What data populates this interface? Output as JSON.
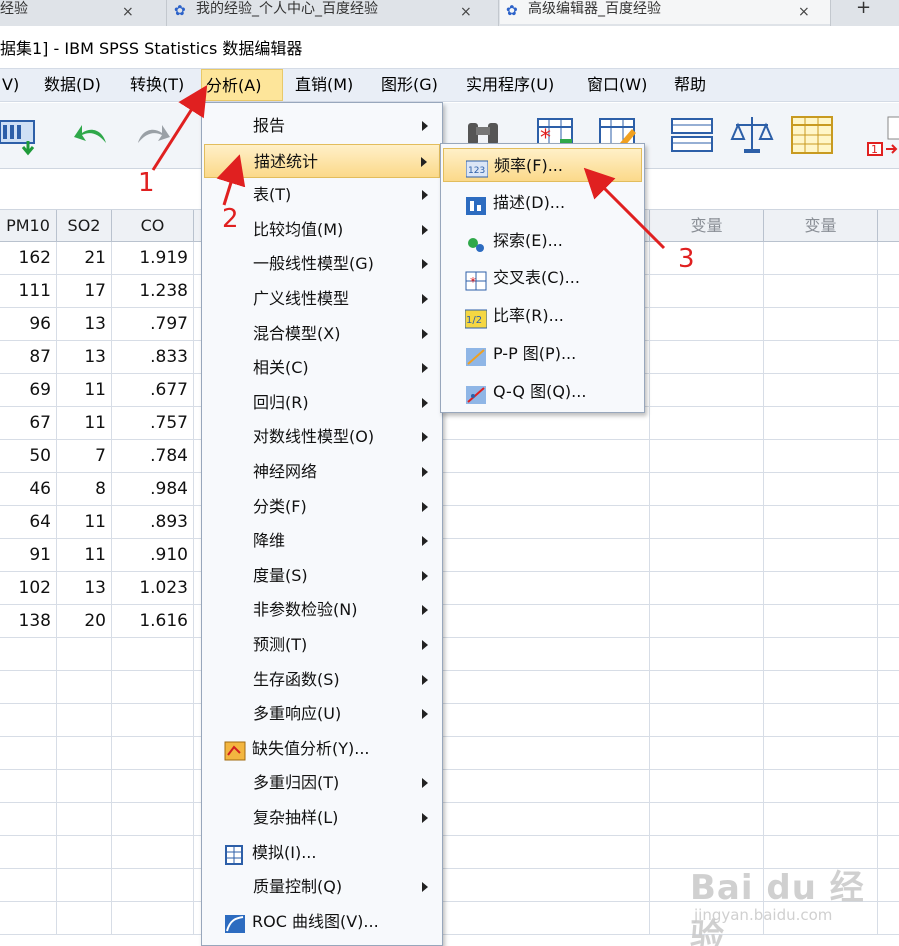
{
  "browser_tabs": [
    {
      "title": "经验",
      "close": "×"
    },
    {
      "title": "我的经验_个人中心_百度经验",
      "close": "×"
    },
    {
      "title": "高级编辑器_百度经验",
      "close": "×"
    }
  ],
  "new_tab": "+",
  "window_title": "据集1] - IBM SPSS Statistics 数据编辑器",
  "menubar": [
    {
      "label": "V)"
    },
    {
      "label": "数据(D)"
    },
    {
      "label": "转换(T)"
    },
    {
      "label": "分析(A)"
    },
    {
      "label": "直销(M)"
    },
    {
      "label": "图形(G)"
    },
    {
      "label": "实用程序(U)"
    },
    {
      "label": "窗口(W)"
    },
    {
      "label": "帮助"
    }
  ],
  "grid": {
    "columns": [
      "PM10",
      "SO2",
      "CO"
    ],
    "variable_headers": [
      "变量",
      "变量"
    ],
    "rows": [
      [
        "162",
        "21",
        "1.919"
      ],
      [
        "111",
        "17",
        "1.238"
      ],
      [
        "96",
        "13",
        ".797"
      ],
      [
        "87",
        "13",
        ".833"
      ],
      [
        "69",
        "11",
        ".677"
      ],
      [
        "67",
        "11",
        ".757"
      ],
      [
        "50",
        "7",
        ".784"
      ],
      [
        "46",
        "8",
        ".984"
      ],
      [
        "64",
        "11",
        ".893"
      ],
      [
        "91",
        "11",
        ".910"
      ],
      [
        "102",
        "13",
        "1.023"
      ],
      [
        "138",
        "20",
        "1.616"
      ]
    ]
  },
  "analyze_menu": {
    "items": [
      {
        "label": "报告",
        "submenu": true
      },
      {
        "label": "描述统计",
        "submenu": true,
        "highlighted": true
      },
      {
        "label": "表(T)",
        "submenu": true
      },
      {
        "label": "比较均值(M)",
        "submenu": true
      },
      {
        "label": "一般线性模型(G)",
        "submenu": true
      },
      {
        "label": "广义线性模型",
        "submenu": true
      },
      {
        "label": "混合模型(X)",
        "submenu": true
      },
      {
        "label": "相关(C)",
        "submenu": true
      },
      {
        "label": "回归(R)",
        "submenu": true
      },
      {
        "label": "对数线性模型(O)",
        "submenu": true
      },
      {
        "label": "神经网络",
        "submenu": true
      },
      {
        "label": "分类(F)",
        "submenu": true
      },
      {
        "label": "降维",
        "submenu": true
      },
      {
        "label": "度量(S)",
        "submenu": true
      },
      {
        "label": "非参数检验(N)",
        "submenu": true
      },
      {
        "label": "预测(T)",
        "submenu": true
      },
      {
        "label": "生存函数(S)",
        "submenu": true
      },
      {
        "label": "多重响应(U)",
        "submenu": true
      },
      {
        "label": "缺失值分析(Y)...",
        "submenu": false,
        "icon": "missing-values-icon"
      },
      {
        "label": "多重归因(T)",
        "submenu": true
      },
      {
        "label": "复杂抽样(L)",
        "submenu": true
      },
      {
        "label": "模拟(I)...",
        "submenu": false,
        "icon": "simulation-icon"
      },
      {
        "label": "质量控制(Q)",
        "submenu": true
      },
      {
        "label": "ROC 曲线图(V)...",
        "submenu": false,
        "icon": "roc-curve-icon"
      }
    ]
  },
  "descriptives_submenu": {
    "items": [
      {
        "label": "频率(F)...",
        "icon": "frequencies-icon",
        "icon_text": "123",
        "highlighted": true
      },
      {
        "label": "描述(D)...",
        "icon": "descriptives-icon"
      },
      {
        "label": "探索(E)...",
        "icon": "explore-icon"
      },
      {
        "label": "交叉表(C)...",
        "icon": "crosstabs-icon"
      },
      {
        "label": "比率(R)...",
        "icon": "ratio-icon",
        "icon_text": "1/2"
      },
      {
        "label": "P-P 图(P)...",
        "icon": "pp-plot-icon"
      },
      {
        "label": "Q-Q 图(Q)...",
        "icon": "qq-plot-icon"
      }
    ]
  },
  "annotations": [
    "1",
    "2",
    "3"
  ],
  "watermark": {
    "logo": "Bai du 经验",
    "url": "jingyan.baidu.com"
  },
  "colors": {
    "highlight": "#fbd98a",
    "annotation": "#e02020",
    "menubar": "#e9eef6"
  }
}
